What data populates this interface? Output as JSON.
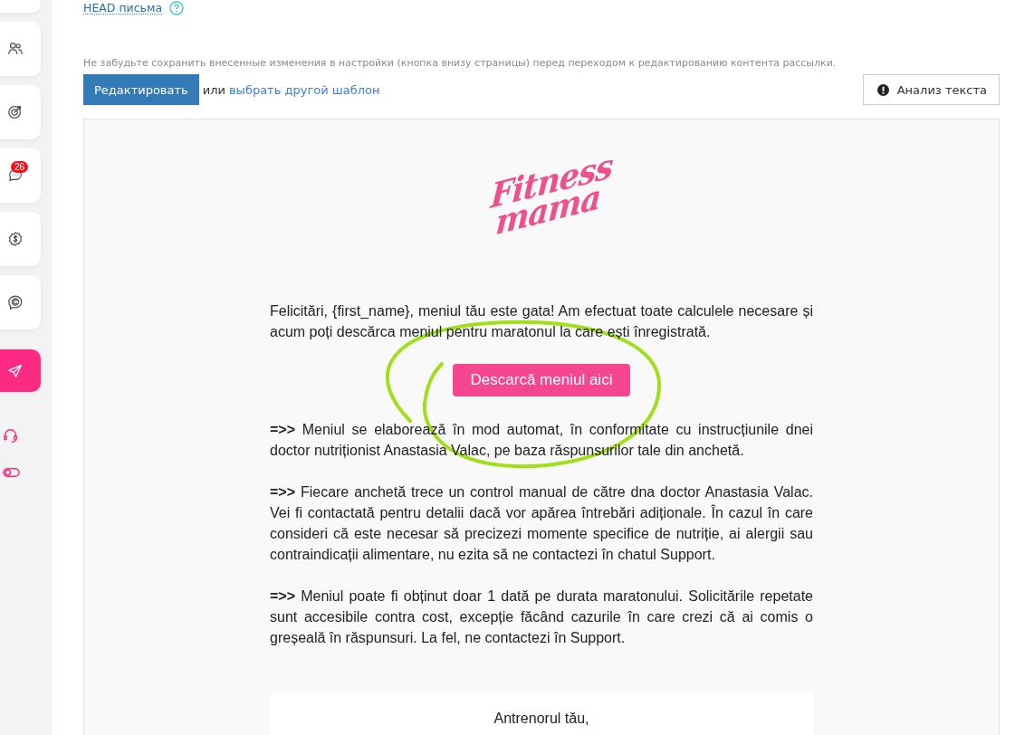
{
  "sidebar": {
    "items": [
      {
        "kind": "people",
        "selected": false
      },
      {
        "kind": "target",
        "selected": false
      },
      {
        "kind": "chat",
        "badge": "26",
        "selected": false
      },
      {
        "kind": "dollar",
        "selected": false
      },
      {
        "kind": "mention",
        "selected": false
      },
      {
        "kind": "send",
        "selected": true
      }
    ]
  },
  "head_link": "HEAD письма",
  "notice": "Не забудьте сохранить внесенные изменения в настройки (кнопка внизу страницы) перед переходом к редактированию контента рассылки.",
  "toolbar": {
    "edit_button": "Редактировать",
    "or_text": "или",
    "template_link": "выбрать другой шаблон",
    "analyze_button": "Анализ текста"
  },
  "email": {
    "logo": [
      "Fitness",
      "mama"
    ],
    "intro": "Felicitări, {first_name}, meniul tău este gata! Am efectuat toate calculele necesare și acum poți descărca meniul pentru maratonul la care ești înregistrată.",
    "cta": "Descarcă meniul aici",
    "paragraphs": [
      "**=>>** Meniul se elaborează în mod automat, în conformitate cu instrucțiunile dnei doctor nutriționist Anastasia Valac, pe baza răspunsurilor tale din anchetă.",
      "**=>>** Fiecare anchetă trece un control manual de către dna doctor Anastasia Valac. Vei fi contactată pentru detalii dacă vor apărea întrebări adiționale. În cazul în care consideri că este necesar să precizezi momente specifice de nutriție, ai alergii sau contraindicații alimentare, nu ezita să ne contactezi în chatul Support.",
      "**=>>** Meniul poate fi obținut doar 1 dată pe durata maratonului. Solicitările repetate sunt accesibile contra cost, excepție făcând cazurile în care crezi că ai comis o greșeală în răspunsuri. La fel, ne contactezi în Support."
    ],
    "signature": "Antrenorul tău,"
  }
}
